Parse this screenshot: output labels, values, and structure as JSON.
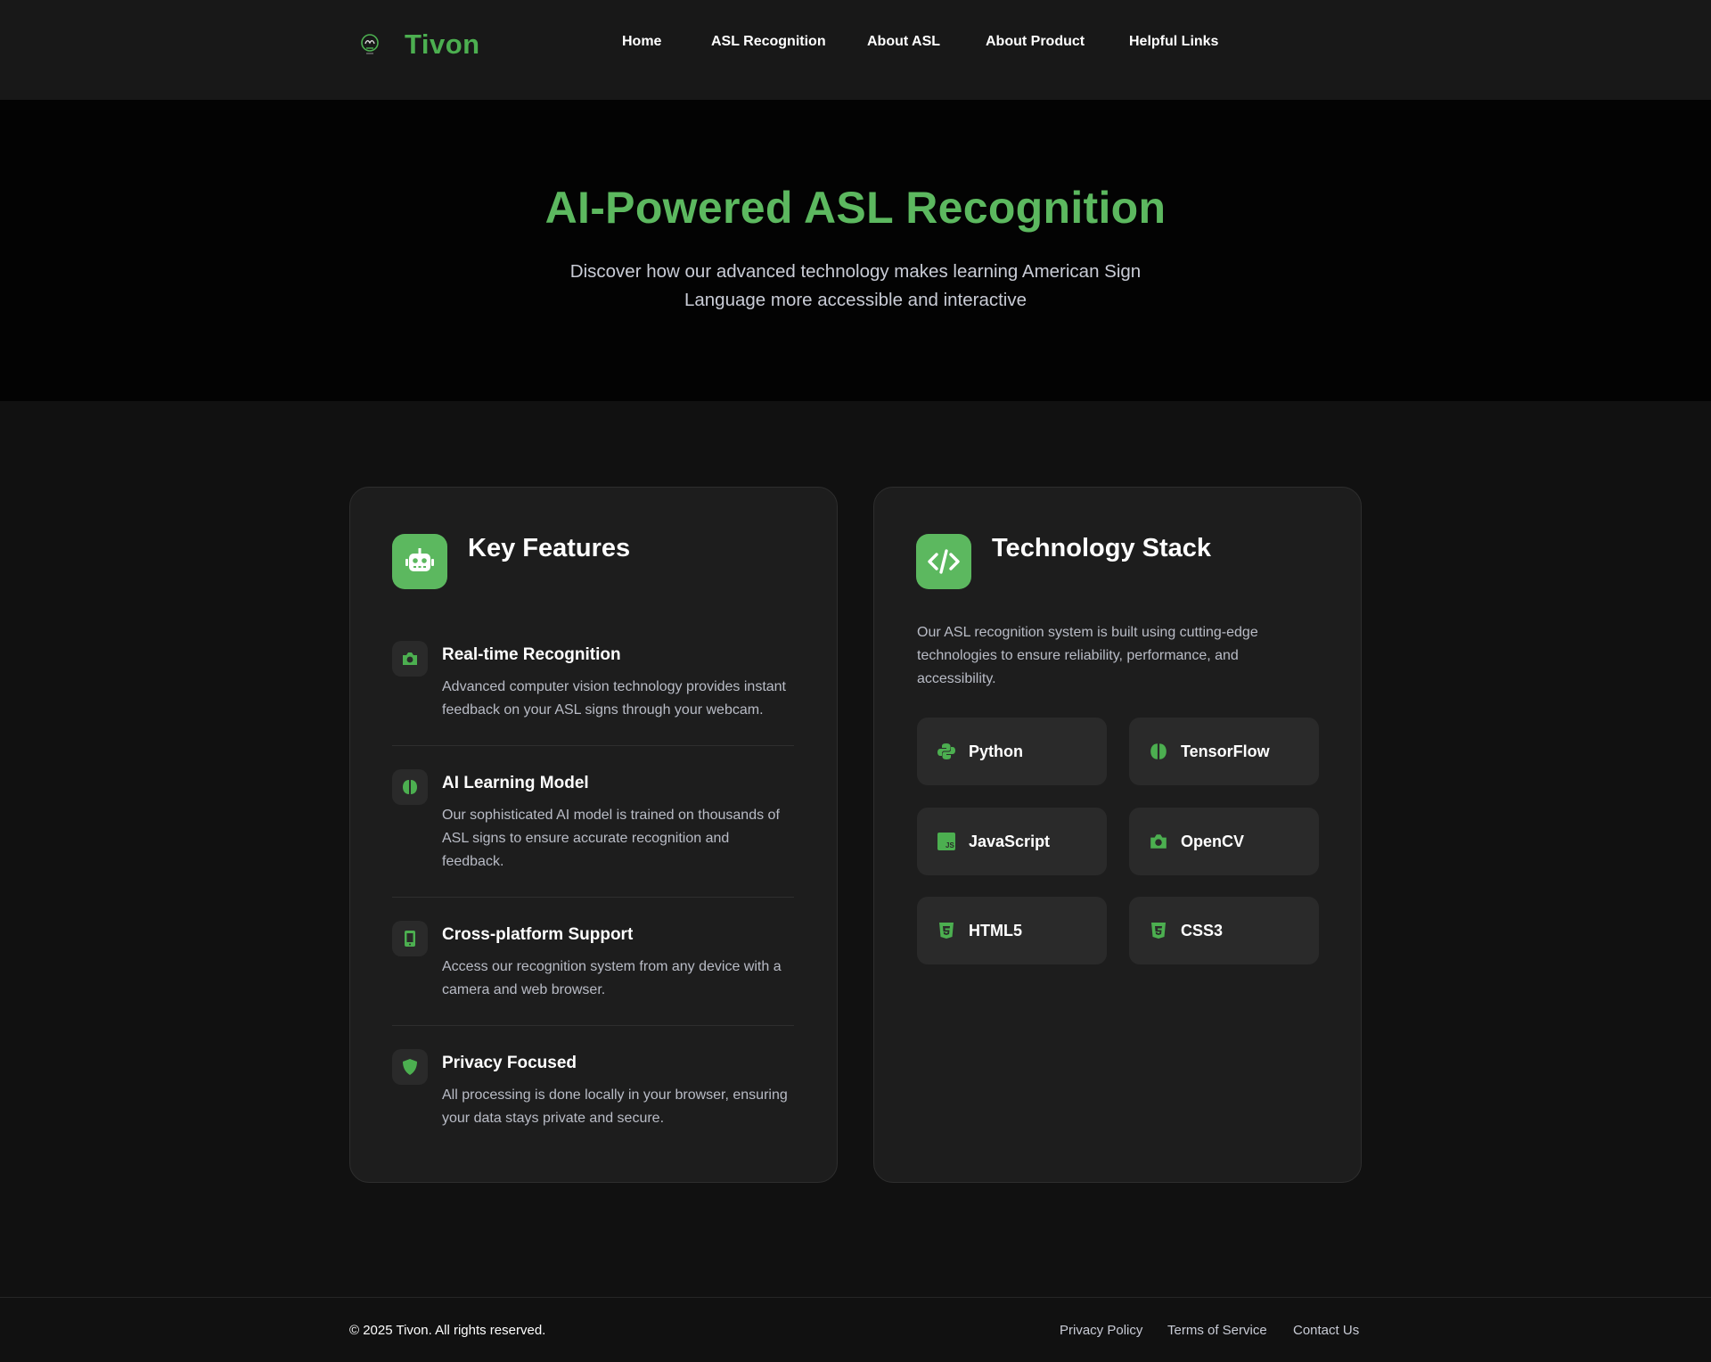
{
  "brand": {
    "name": "Tivon",
    "logo_icon": "hand-sign-icon",
    "accent": "#4caf50"
  },
  "nav": {
    "links": [
      "Home",
      "ASL Recognition",
      "About ASL",
      "About Product",
      "Helpful Links"
    ]
  },
  "hero": {
    "title": "AI-Powered ASL Recognition",
    "subtitle": "Discover how our advanced technology makes learning American Sign Language more accessible and interactive"
  },
  "features_card": {
    "title": "Key Features",
    "icon": "robot-icon",
    "items": [
      {
        "icon": "camera-icon",
        "title": "Real-time Recognition",
        "desc": "Advanced computer vision technology provides instant feedback on your ASL signs through your webcam."
      },
      {
        "icon": "brain-icon",
        "title": "AI Learning Model",
        "desc": "Our sophisticated AI model is trained on thousands of ASL signs to ensure accurate recognition and feedback."
      },
      {
        "icon": "mobile-icon",
        "title": "Cross-platform Support",
        "desc": "Access our recognition system from any device with a camera and web browser."
      },
      {
        "icon": "shield-icon",
        "title": "Privacy Focused",
        "desc": "All processing is done locally in your browser, ensuring your data stays private and secure."
      }
    ]
  },
  "tech_card": {
    "title": "Technology Stack",
    "icon": "code-icon",
    "description": "Our ASL recognition system is built using cutting-edge technologies to ensure reliability, performance, and accessibility.",
    "items": [
      {
        "icon": "python-icon",
        "name": "Python"
      },
      {
        "icon": "brain-icon",
        "name": "TensorFlow"
      },
      {
        "icon": "javascript-icon",
        "name": "JavaScript"
      },
      {
        "icon": "camera-icon",
        "name": "OpenCV"
      },
      {
        "icon": "html5-icon",
        "name": "HTML5"
      },
      {
        "icon": "css3-icon",
        "name": "CSS3"
      }
    ]
  },
  "footer": {
    "copyright": "© 2025 Tivon. All rights reserved.",
    "links": [
      "Privacy Policy",
      "Terms of Service",
      "Contact Us"
    ]
  }
}
